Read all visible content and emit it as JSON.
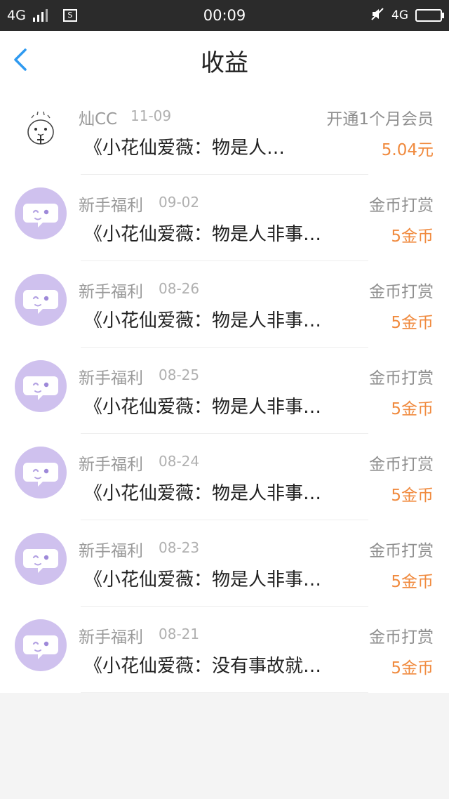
{
  "status_bar": {
    "network_left": "4G",
    "sim_label": "S",
    "time": "00:09",
    "network_right": "4G"
  },
  "header": {
    "title": "收益"
  },
  "colors": {
    "accent_blue": "#2f9af0",
    "amount_orange": "#f08a3e"
  },
  "items": [
    {
      "name": "灿CC",
      "date": "11-09",
      "type": "开通1个月会员",
      "title": "《小花仙爱薇：物是人…",
      "amount": "5.04元",
      "avatar": "user-avatar"
    },
    {
      "name": "新手福利",
      "date": "09-02",
      "type": "金币打赏",
      "title": "《小花仙爱薇：物是人非事…",
      "amount": "5金币",
      "avatar": "chat-bubble-icon"
    },
    {
      "name": "新手福利",
      "date": "08-26",
      "type": "金币打赏",
      "title": "《小花仙爱薇：物是人非事…",
      "amount": "5金币",
      "avatar": "chat-bubble-icon"
    },
    {
      "name": "新手福利",
      "date": "08-25",
      "type": "金币打赏",
      "title": "《小花仙爱薇：物是人非事…",
      "amount": "5金币",
      "avatar": "chat-bubble-icon"
    },
    {
      "name": "新手福利",
      "date": "08-24",
      "type": "金币打赏",
      "title": "《小花仙爱薇：物是人非事…",
      "amount": "5金币",
      "avatar": "chat-bubble-icon"
    },
    {
      "name": "新手福利",
      "date": "08-23",
      "type": "金币打赏",
      "title": "《小花仙爱薇：物是人非事…",
      "amount": "5金币",
      "avatar": "chat-bubble-icon"
    },
    {
      "name": "新手福利",
      "date": "08-21",
      "type": "金币打赏",
      "title": "《小花仙爱薇：没有事故就…",
      "amount": "5金币",
      "avatar": "chat-bubble-icon"
    }
  ]
}
